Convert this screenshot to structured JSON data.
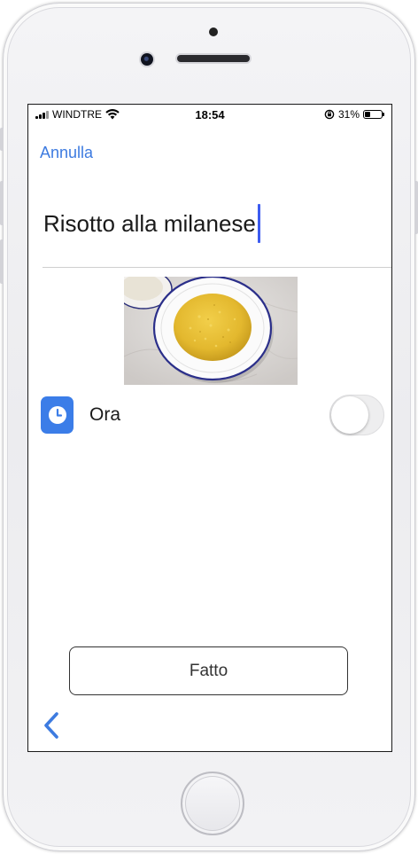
{
  "status_bar": {
    "carrier": "WINDTRE",
    "time": "18:54",
    "battery": "31%",
    "battery_level": 0.31,
    "icons": [
      "signal-icon",
      "wifi-icon",
      "orientation-lock-icon",
      "battery-icon"
    ]
  },
  "header": {
    "cancel_label": "Annulla"
  },
  "title_field": {
    "value": "Risotto alla milanese"
  },
  "time_option": {
    "label": "Ora",
    "icon": "clock-icon",
    "toggle_on": false
  },
  "footer": {
    "done_label": "Fatto",
    "back_icon": "chevron-left-icon"
  },
  "colors": {
    "accent": "#3d7be0",
    "caret": "#3d5cf0",
    "icon_tile": "#3b7de8"
  }
}
